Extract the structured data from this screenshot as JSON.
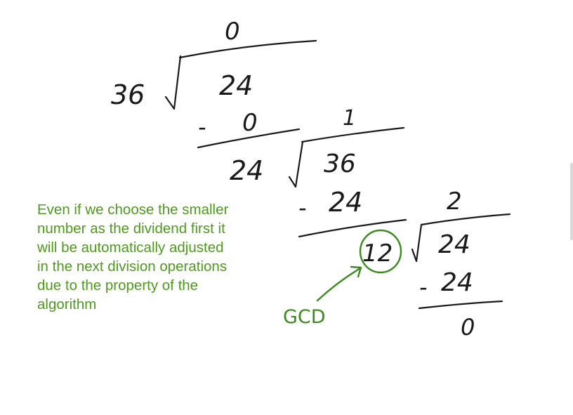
{
  "step1": {
    "divisor": "36",
    "dividend": "24",
    "quotient": "0",
    "subtract": "0",
    "minus": "-",
    "remainder": "24"
  },
  "step2": {
    "divisor": "24",
    "dividend": "36",
    "quotient": "1",
    "subtract": "24",
    "minus": "-",
    "remainder": "12"
  },
  "step3": {
    "divisor": "12",
    "dividend": "24",
    "quotient": "2",
    "subtract": "24",
    "minus": "-",
    "remainder": "0"
  },
  "gcd_label": "GCD",
  "note_lines": [
    "Even if we choose the smaller",
    "number as the dividend first it",
    "will be automatically adjusted",
    "in the next division operations",
    "due to the property of the",
    "algorithm"
  ],
  "colors": {
    "ink": "#1a1a1a",
    "annotation": "#3a8a1e",
    "note_text": "#4e9a1c"
  }
}
